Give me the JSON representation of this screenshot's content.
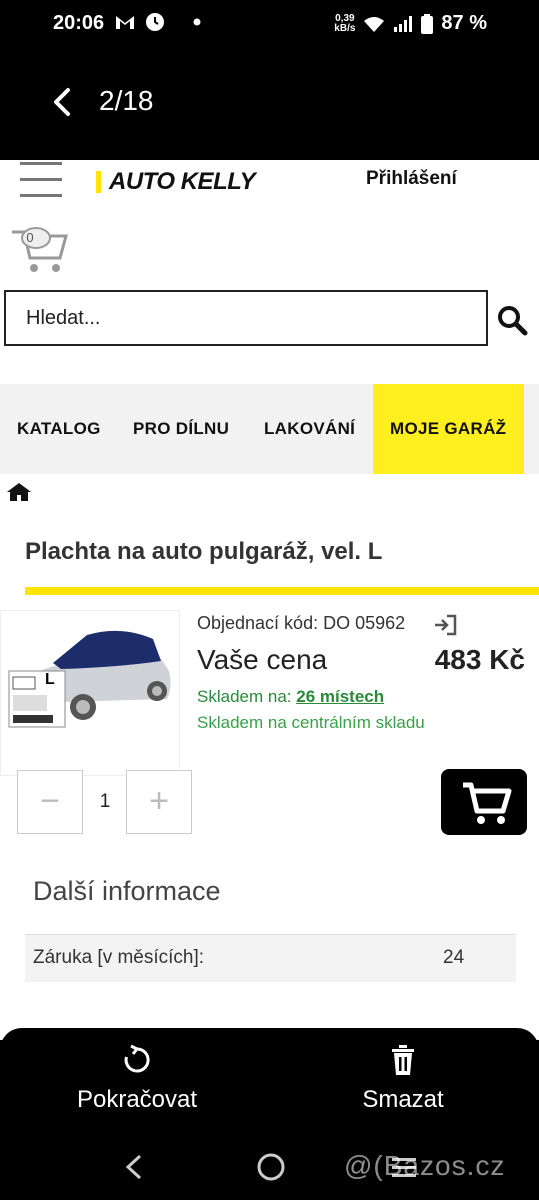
{
  "status_bar": {
    "time": "20:06",
    "net_speed_value": "0,39",
    "net_speed_unit": "kB/s",
    "battery": "87 %"
  },
  "gallery": {
    "counter": "2/18"
  },
  "site": {
    "logo_text": "AUTO KELLY",
    "login": "Přihlášení",
    "cart_count": "0",
    "search_placeholder": "Hledat...",
    "nav": [
      {
        "label": "KATALOG"
      },
      {
        "label": "PRO DÍLNU"
      },
      {
        "label": "LAKOVÁNÍ"
      },
      {
        "label": "MOJE GARÁŽ",
        "active": true
      }
    ],
    "accent_color": "#ffe400"
  },
  "product": {
    "title": "Plachta na auto pulgaráž, vel. L",
    "order_code": "Objednací kód: DO 05962",
    "price_label": "Vaše cena",
    "price_value": "483 Kč",
    "stock_prefix": "Skladem na:",
    "stock_link": "26 místech",
    "stock_central": "Skladem na centrálním skladu",
    "image_size_badge": "L",
    "quantity": "1",
    "minus_symbol": "−",
    "plus_symbol": "+"
  },
  "more_info": {
    "heading": "Další informace",
    "rows": [
      {
        "label": "Záruka [v měsících]:",
        "value": "24"
      }
    ]
  },
  "bottom_sheet": {
    "continue_label": "Pokračovat",
    "delete_label": "Smazat"
  },
  "watermark": "@(Bazos.cz"
}
